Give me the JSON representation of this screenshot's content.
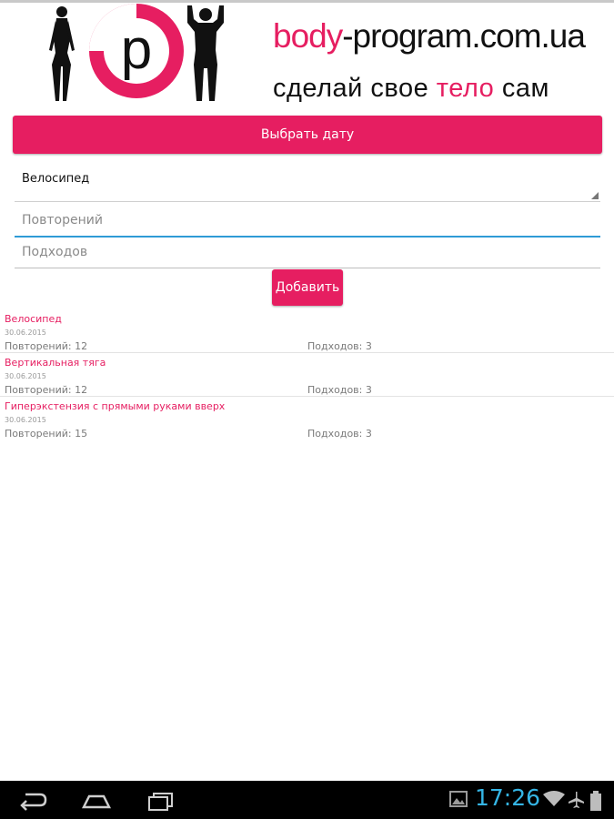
{
  "header": {
    "site_url_prefix": "body",
    "site_url_rest": "-program.com.ua",
    "slogan_start": "сделай свое ",
    "slogan_highlight": "тело",
    "slogan_end": " сам",
    "logo_letter": "p"
  },
  "form": {
    "date_button_label": "Выбрать дату",
    "exercise_selected": "Велосипед",
    "reps_placeholder": "Повторений",
    "sets_placeholder": "Подходов",
    "add_button_label": "Добавить"
  },
  "entries": [
    {
      "name": "Велосипед",
      "date": "30.06.2015",
      "reps": "Повторений: 12",
      "sets": "Подходов: 3"
    },
    {
      "name": "Вертикальная тяга",
      "date": "30.06.2015",
      "reps": "Повторений: 12",
      "sets": "Подходов: 3"
    },
    {
      "name": "Гиперэкстензия с прямыми руками вверх",
      "date": "30.06.2015",
      "reps": "Повторений: 15",
      "sets": "Подходов: 3"
    }
  ],
  "statusbar": {
    "time": "17:26"
  },
  "icons": {
    "back": "back-icon",
    "home": "home-icon",
    "recents": "recents-icon",
    "gallery": "gallery-notification-icon",
    "wifi": "wifi-icon",
    "airplane": "airplane-mode-icon",
    "battery": "battery-icon"
  },
  "colors": {
    "accent": "#e61e61",
    "focus": "#2f9bd6",
    "clock": "#35b5e5"
  }
}
